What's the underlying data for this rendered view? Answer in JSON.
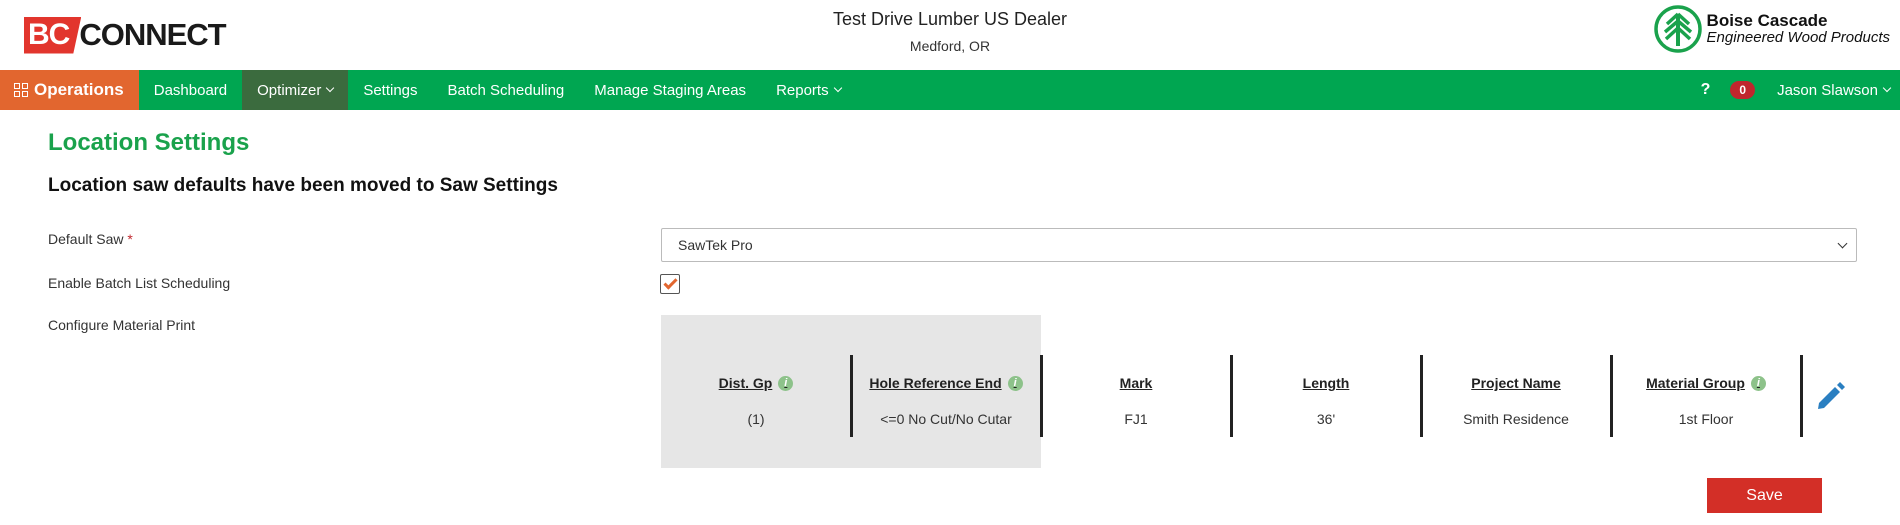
{
  "header": {
    "logo_bc": "BC",
    "logo_connect": "CONNECT",
    "dealer_name": "Test Drive Lumber US Dealer",
    "dealer_location": "Medford, OR",
    "brand_line1": "Boise Cascade",
    "brand_line2": "Engineered Wood Products"
  },
  "nav": {
    "operations_label": "Operations",
    "items": [
      {
        "label": "Dashboard"
      },
      {
        "label": "Optimizer"
      },
      {
        "label": "Settings"
      },
      {
        "label": "Batch Scheduling"
      },
      {
        "label": "Manage Staging Areas"
      },
      {
        "label": "Reports"
      }
    ],
    "help_label": "?",
    "notification_count": "0",
    "user_name": "Jason Slawson"
  },
  "page": {
    "title": "Location Settings",
    "notice": "Location saw defaults have been moved to Saw Settings",
    "default_saw_label": "Default Saw",
    "required_mark": "*",
    "default_saw_value": "SawTek Pro",
    "batch_scheduling_label": "Enable Batch List Scheduling",
    "batch_scheduling_checked": true,
    "material_print_label": "Configure Material Print",
    "material_print_columns": [
      {
        "header": "Dist. Gp",
        "value": "(1)",
        "info": true
      },
      {
        "header": "Hole Reference End",
        "value": "<=0 No Cut/No Cutar",
        "info": true
      },
      {
        "header": "Mark",
        "value": "FJ1",
        "info": false
      },
      {
        "header": "Length",
        "value": "36'",
        "info": false
      },
      {
        "header": "Project Name",
        "value": "Smith Residence",
        "info": false
      },
      {
        "header": "Material Group",
        "value": "1st Floor",
        "info": true
      }
    ],
    "info_glyph": "i",
    "save_label": "Save"
  },
  "colors": {
    "nav_green": "#00a651",
    "operations_orange": "#e2662f",
    "title_green": "#1aa24c",
    "save_red": "#d32f27",
    "brand_red": "#e2352d"
  }
}
